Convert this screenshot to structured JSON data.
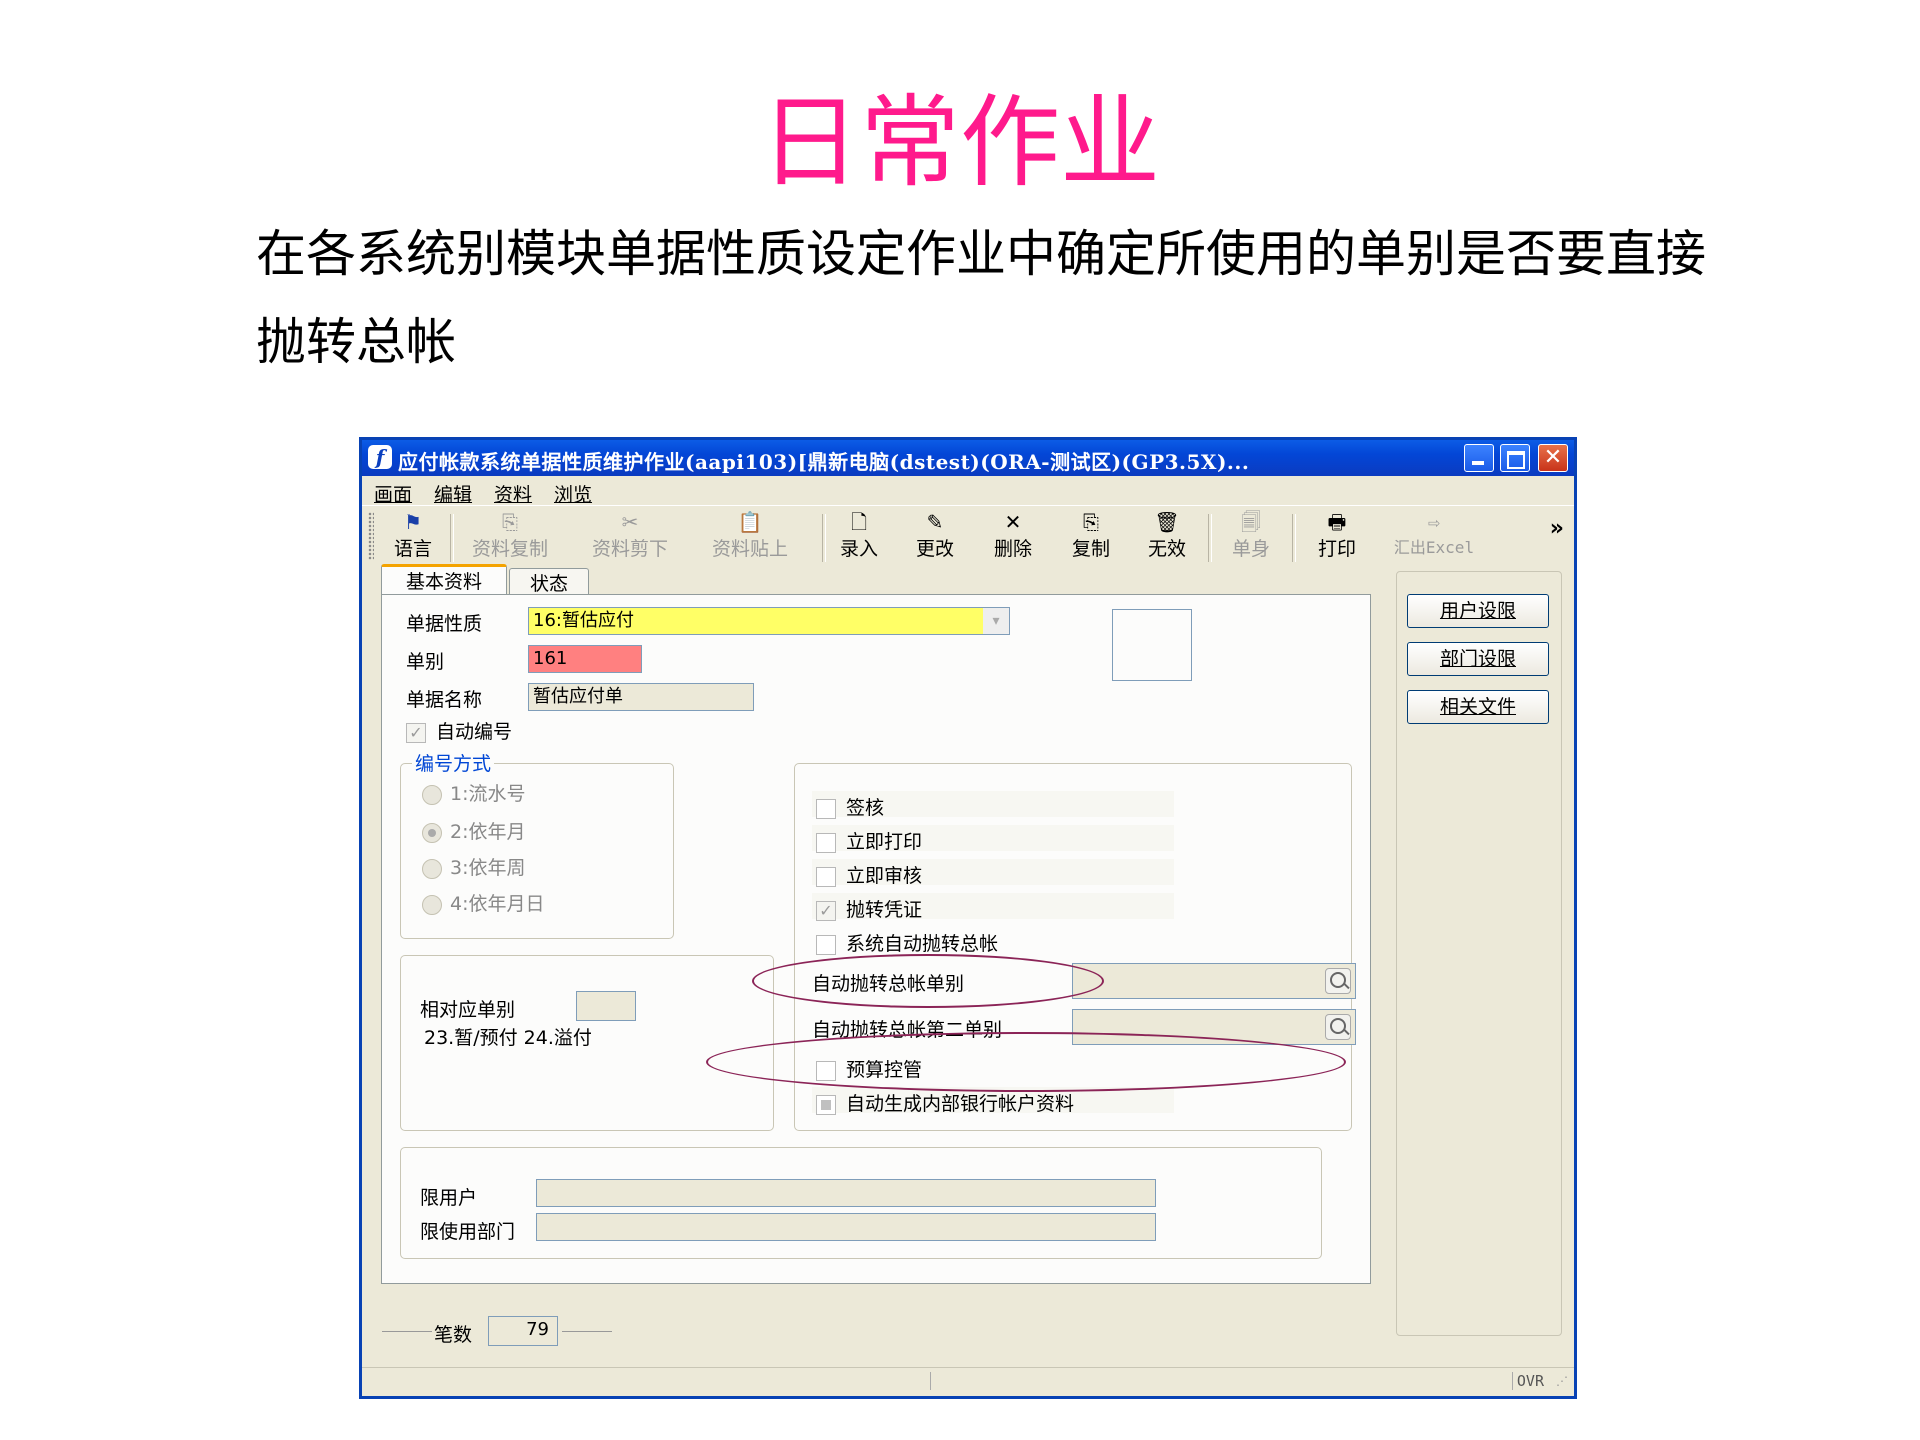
{
  "slide": {
    "title": "日常作业",
    "description": "在各系统别模块单据性质设定作业中确定所使用的单别是否要直接抛转总帐"
  },
  "window": {
    "title": "应付帐款系统单据性质维护作业(aapi103)[鼎新电脑(dstest)(ORA-测试区)(GP3.5X)...",
    "close_glyph": "✕"
  },
  "menu": [
    "画面",
    "编辑",
    "资料",
    "浏览"
  ],
  "toolbar": {
    "language": "语言",
    "copy_data": "资料复制",
    "cut_data": "资料剪下",
    "paste_data": "资料贴上",
    "add": "录入",
    "edit": "更改",
    "delete": "删除",
    "copy": "复制",
    "invalidate": "无效",
    "detail": "单身",
    "print": "打印",
    "export_excel": "汇出Excel",
    "more": "»"
  },
  "tabs": [
    "基本资料",
    "状态"
  ],
  "form": {
    "doc_type_label": "单据性质",
    "doc_type_value": "16:暂估应付",
    "doc_code_label": "单别",
    "doc_code_value": "161",
    "doc_name_label": "单据名称",
    "doc_name_value": "暂估应付单",
    "auto_number_label": "自动编号",
    "auto_number_checked": true,
    "numbering_group_title": "编号方式",
    "numbering_options": [
      "1:流水号",
      "2:依年月",
      "3:依年周",
      "4:依年月日"
    ],
    "numbering_selected": "2:依年月",
    "corresponding_label": "相对应单别",
    "corresponding_value": "",
    "corresponding_note": "23.暂/预付 24.溢付",
    "checkboxes": {
      "sign": "签核",
      "print_now": "立即打印",
      "approve_now": "立即审核",
      "transfer_voucher": "抛转凭证",
      "auto_transfer_gl": "系统自动抛转总帐",
      "budget_control": "预算控管",
      "auto_bank_account": "自动生成内部银行帐户资料"
    },
    "auto_gl_doc_label": "自动抛转总帐单别",
    "auto_gl_doc2_label": "自动抛转总帐第二单别",
    "limit_user_label": "限用户",
    "limit_dept_label": "限使用部门"
  },
  "side_buttons": [
    "用户设限",
    "部门设限",
    "相关文件"
  ],
  "footer": {
    "count_label": "笔数",
    "count_value": "79",
    "ovr": "OVR"
  },
  "colors": {
    "title_pink": "#ff1a8c",
    "highlight_yellow": "#ffff66",
    "highlight_red": "#ff8080",
    "oval": "#8b2457"
  }
}
